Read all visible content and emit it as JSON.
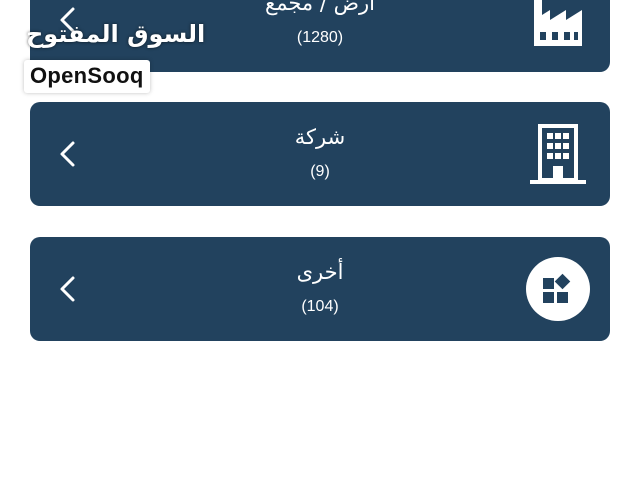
{
  "categories": [
    {
      "title": "أرض / مجمع",
      "count": "(1280)",
      "icon": "factory-icon"
    },
    {
      "title": "شركة",
      "count": "(9)",
      "icon": "office-building-icon"
    },
    {
      "title": "أخرى",
      "count": "(104)",
      "icon": "widgets-icon"
    }
  ],
  "logo": {
    "arabic": "السوق المفتوح",
    "english": "OpenSooq"
  },
  "colors": {
    "card_background": "#22425e",
    "card_text": "#ffffff",
    "page_background": "#ffffff"
  }
}
